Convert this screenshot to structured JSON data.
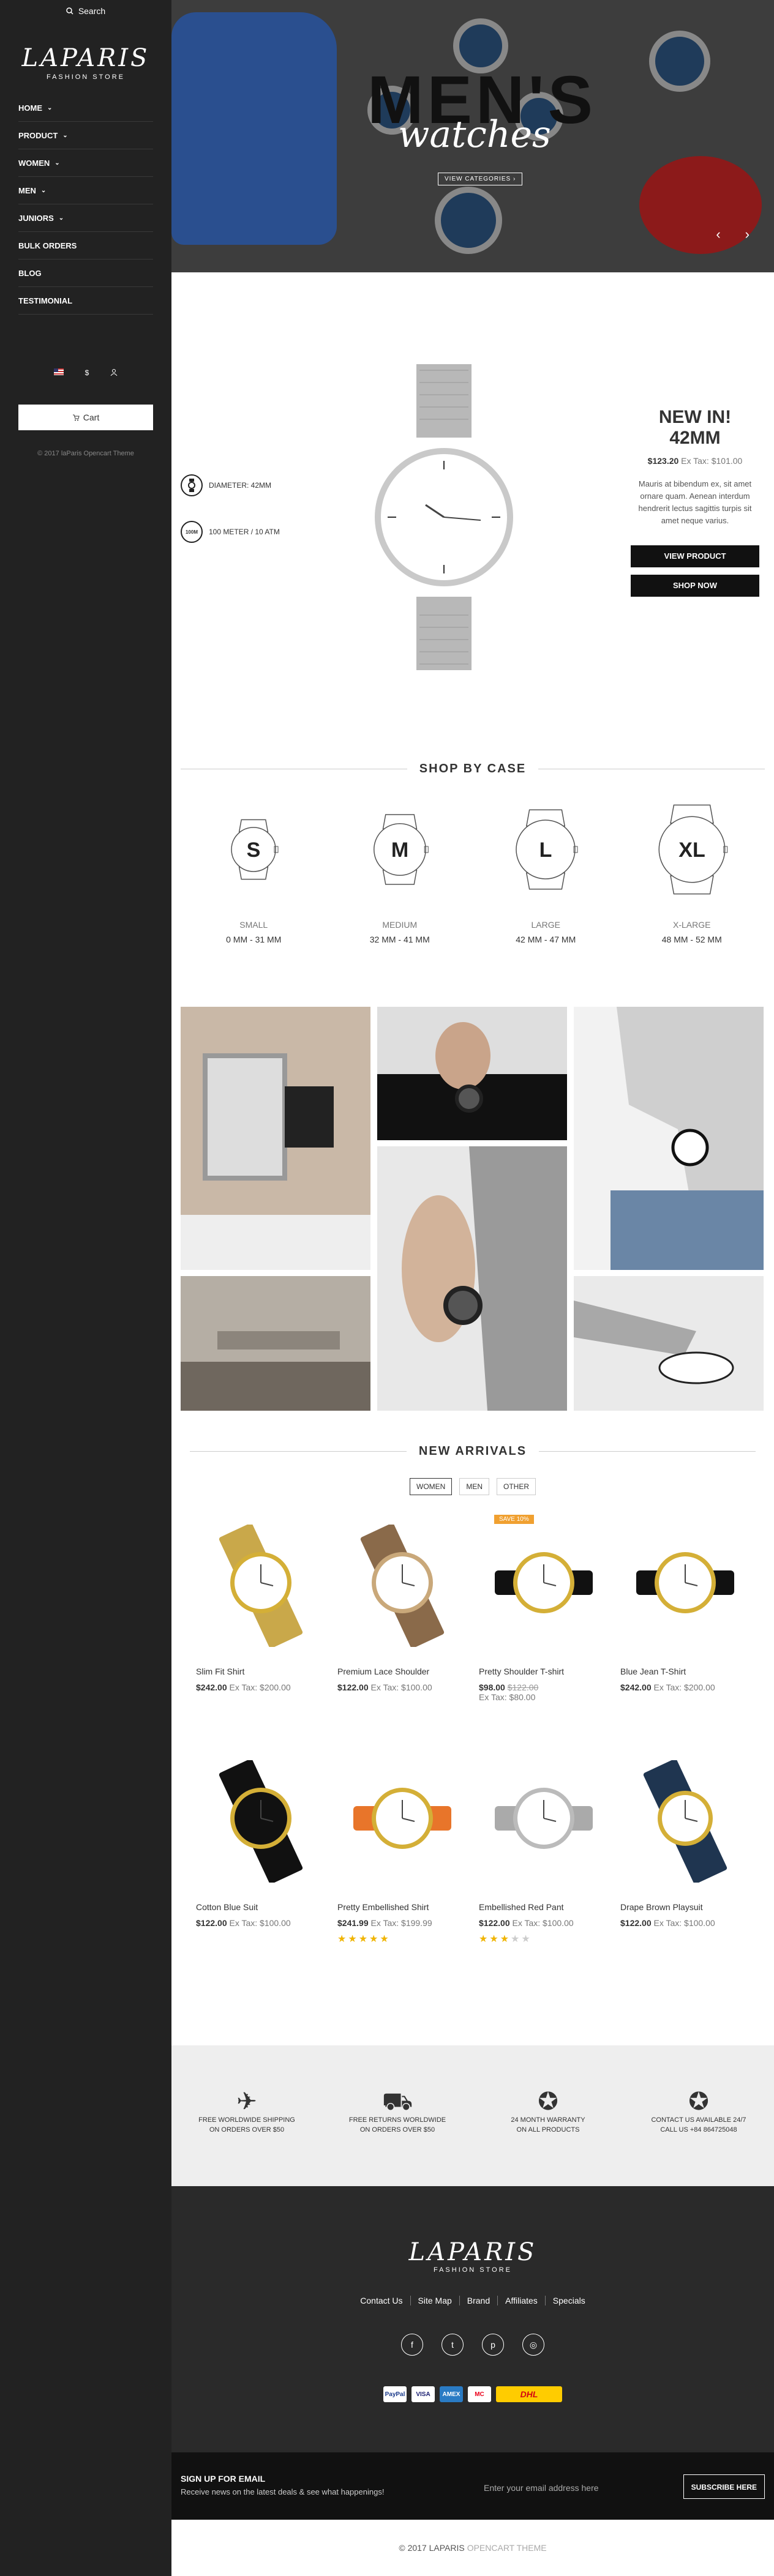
{
  "sidebar": {
    "search_label": "Search",
    "logo_main": "LAPARIS",
    "logo_sub": "FASHION STORE",
    "menu": [
      {
        "label": "HOME",
        "chevron": true
      },
      {
        "label": "PRODUCT",
        "chevron": true
      },
      {
        "label": "WOMEN",
        "chevron": true
      },
      {
        "label": "MEN",
        "chevron": true
      },
      {
        "label": "JUNIORS",
        "chevron": true
      },
      {
        "label": "BULK ORDERS",
        "chevron": false
      },
      {
        "label": "BLOG",
        "chevron": false
      },
      {
        "label": "TESTIMONIAL",
        "chevron": false
      }
    ],
    "cart_label": "Cart",
    "copyright": "© 2017 laParis Opencart Theme"
  },
  "hero": {
    "title": "MEN'S",
    "script": "watches",
    "button": "VIEW CATEGORIES ›",
    "prev": "‹",
    "next": "›"
  },
  "feature": {
    "specs": [
      {
        "icon": "diameter-icon",
        "label": "DIAMETER: 42MM"
      },
      {
        "icon": "water-resistance-icon",
        "badge": "100M",
        "label": "100 METER / 10 ATM"
      }
    ],
    "title_line1": "NEW IN!",
    "title_line2": "42MM",
    "price": "$123.20",
    "tax": "Ex Tax: $101.00",
    "description": "Mauris at bibendum ex, sit amet ornare quam. Aenean interdum hendrerit lectus sagittis turpis sit amet neque varius.",
    "btn_view": "VIEW PRODUCT",
    "btn_shop": "SHOP NOW"
  },
  "shop_by_case": {
    "title": "SHOP BY CASE",
    "items": [
      {
        "letter": "S",
        "name": "SMALL",
        "range": "0 MM - 31 MM"
      },
      {
        "letter": "M",
        "name": "MEDIUM",
        "range": "32 MM - 41 MM"
      },
      {
        "letter": "L",
        "name": "LARGE",
        "range": "42 MM - 47 MM"
      },
      {
        "letter": "XL",
        "name": "X-LARGE",
        "range": "48 MM - 52 MM"
      }
    ]
  },
  "new_arrivals": {
    "title": "NEW ARRIVALS",
    "filters": [
      "WOMEN",
      "MEN",
      "OTHER"
    ],
    "active_filter": "WOMEN",
    "products": [
      {
        "name": "Slim Fit Shirt",
        "price": "$242.00",
        "tax": "Ex Tax: $200.00",
        "strap": "#c9a84a",
        "face": "#fff",
        "case": "#d4af37"
      },
      {
        "name": "Premium Lace Shoulder",
        "price": "$122.00",
        "tax": "Ex Tax: $100.00",
        "strap": "#8a6a4a",
        "face": "#fff",
        "case": "#c9a87a"
      },
      {
        "name": "Pretty Shoulder T-shirt",
        "price": "$98.00",
        "old_price": "$122.00",
        "tax": "Ex Tax: $80.00",
        "sale": "SAVE 10%",
        "strap": "#111",
        "face": "#fff",
        "case": "#d4af37"
      },
      {
        "name": "Blue Jean T-Shirt",
        "price": "$242.00",
        "tax": "Ex Tax: $200.00",
        "strap": "#111",
        "face": "#fff",
        "case": "#d4af37"
      },
      {
        "name": "Cotton Blue Suit",
        "price": "$122.00",
        "tax": "Ex Tax: $100.00",
        "strap": "#111",
        "face": "#111",
        "case": "#d4af37"
      },
      {
        "name": "Pretty Embellished Shirt",
        "price": "$241.99",
        "tax": "Ex Tax: $199.99",
        "rating": 5,
        "strap": "#e8752a",
        "face": "#fff",
        "case": "#d4af37"
      },
      {
        "name": "Embellished Red Pant",
        "price": "$122.00",
        "tax": "Ex Tax: $100.00",
        "rating": 3,
        "strap": "#aaa",
        "face": "#fff",
        "case": "#bbb"
      },
      {
        "name": "Drape Brown Playsuit",
        "price": "$122.00",
        "tax": "Ex Tax: $100.00",
        "strap": "#1f3550",
        "face": "#fff",
        "case": "#d4af37"
      }
    ]
  },
  "services": [
    {
      "icon": "airplane-icon",
      "glyph": "✈",
      "line1": "FREE WORLDWIDE SHIPPING",
      "line2": "ON ORDERS OVER $50"
    },
    {
      "icon": "truck-icon",
      "glyph": "⛟",
      "line1": "FREE RETURNS WORLDWIDE",
      "line2": "ON ORDERS OVER $50"
    },
    {
      "icon": "award-icon",
      "glyph": "✪",
      "line1": "24 MONTH WARRANTY",
      "line2": "ON ALL PRODUCTS"
    },
    {
      "icon": "support-icon",
      "glyph": "✪",
      "line1": "CONTACT US AVAILABLE 24/7",
      "line2": "CALL US +84 864725048"
    }
  ],
  "footer": {
    "logo_main": "LAPARIS",
    "logo_sub": "FASHION STORE",
    "links": [
      "Contact Us",
      "Site Map",
      "Brand",
      "Affiliates",
      "Specials"
    ],
    "socials": [
      {
        "icon": "facebook-icon",
        "glyph": "f"
      },
      {
        "icon": "twitter-icon",
        "glyph": "t"
      },
      {
        "icon": "pinterest-icon",
        "glyph": "p"
      },
      {
        "icon": "instagram-icon",
        "glyph": "◎"
      }
    ],
    "payments": [
      "PayPal",
      "VISA",
      "AMEX",
      "MC",
      "DHL"
    ]
  },
  "newsletter": {
    "title": "SIGN UP FOR EMAIL",
    "subtitle": "Receive news on the latest deals & see what happenings!",
    "placeholder": "Enter your email address here",
    "button": "SUBSCRIBE HERE"
  },
  "bottom": {
    "copyright": "© 2017 LAPARIS",
    "theme": "OPENCART THEME"
  }
}
